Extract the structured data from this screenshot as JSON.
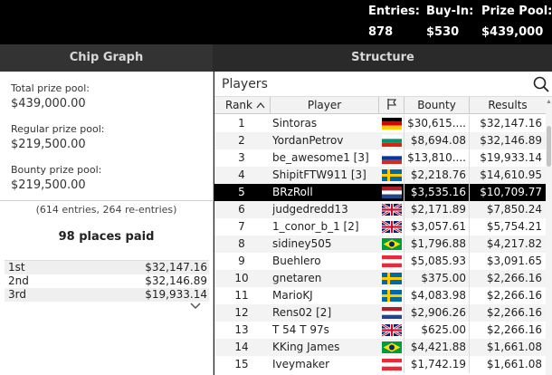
{
  "stats": {
    "entries_label": "Entries:",
    "entries_value": "878",
    "buyin_label": "Buy-In:",
    "buyin_value": "$530",
    "prize_label": "Prize Pool:",
    "prize_value": "$439,000"
  },
  "tabs": {
    "chip_graph": "Chip Graph",
    "structure": "Structure"
  },
  "prizes": {
    "total_label": "Total prize pool:",
    "total_value": "$439,000.00",
    "regular_label": "Regular prize pool:",
    "regular_value": "$219,500.00",
    "bounty_label": "Bounty prize pool:",
    "bounty_value": "$219,500.00",
    "entries_note": "(614 entries, 264 re-entries)",
    "places_paid": "98 places paid",
    "payouts": [
      {
        "place": "1st",
        "amount": "$32,147.16"
      },
      {
        "place": "2nd",
        "amount": "$32,146.89"
      },
      {
        "place": "3rd",
        "amount": "$19,933.14"
      }
    ]
  },
  "players": {
    "title": "Players",
    "columns": {
      "rank": "Rank",
      "player": "Player",
      "bounty": "Bounty",
      "results": "Results"
    },
    "sort_icon": "chevron-up-icon",
    "flag_column_icon": "flag-icon",
    "selected_rank": 5,
    "rows": [
      {
        "rank": "1",
        "player": "Sintoras",
        "flag": "germany",
        "bounty": "$30,615....",
        "results": "$32,147.16"
      },
      {
        "rank": "2",
        "player": "YordanPetrov",
        "flag": "bulgaria",
        "bounty": "$8,694.08",
        "results": "$32,146.89"
      },
      {
        "rank": "3",
        "player": "be_awesome1 [3]",
        "flag": "russia",
        "bounty": "$13,810....",
        "results": "$19,933.14"
      },
      {
        "rank": "4",
        "player": "ShipitFTW911 [3]",
        "flag": "sweden",
        "bounty": "$2,218.76",
        "results": "$14,610.95"
      },
      {
        "rank": "5",
        "player": "BRzRoll",
        "flag": "netherlands",
        "bounty": "$3,535.16",
        "results": "$10,709.77"
      },
      {
        "rank": "6",
        "player": "judgedredd13",
        "flag": "uk",
        "bounty": "$2,171.89",
        "results": "$7,850.24"
      },
      {
        "rank": "7",
        "player": "1_conor_b_1 [2]",
        "flag": "uk",
        "bounty": "$3,057.61",
        "results": "$5,754.21"
      },
      {
        "rank": "8",
        "player": "sidiney505",
        "flag": "brazil",
        "bounty": "$1,796.88",
        "results": "$4,217.82"
      },
      {
        "rank": "9",
        "player": "Buehlero",
        "flag": "austria",
        "bounty": "$5,085.93",
        "results": "$3,091.65"
      },
      {
        "rank": "10",
        "player": "gnetaren",
        "flag": "sweden",
        "bounty": "$375.00",
        "results": "$2,266.16"
      },
      {
        "rank": "11",
        "player": "MarioKJ",
        "flag": "sweden",
        "bounty": "$4,083.98",
        "results": "$2,266.16"
      },
      {
        "rank": "12",
        "player": "Rens02 [2]",
        "flag": "netherlands",
        "bounty": "$2,906.26",
        "results": "$2,266.16"
      },
      {
        "rank": "13",
        "player": "T 54 T 97s",
        "flag": "uk",
        "bounty": "$625.00",
        "results": "$2,266.16"
      },
      {
        "rank": "14",
        "player": "KKing James",
        "flag": "brazil",
        "bounty": "$4,421.88",
        "results": "$1,661.08"
      },
      {
        "rank": "15",
        "player": "Iveymaker",
        "flag": "austria",
        "bounty": "$1,742.19",
        "results": "$1,661.08"
      }
    ]
  },
  "colors": {
    "selected_row_bg": "#000000",
    "topbar_bg": "#000000",
    "tab_bg": "#2a2a2a"
  }
}
